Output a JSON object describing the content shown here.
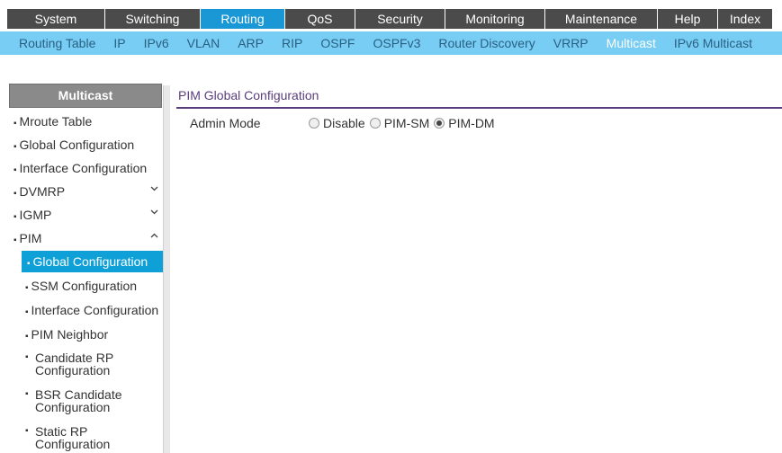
{
  "top_tabs": [
    {
      "label": "System"
    },
    {
      "label": "Switching"
    },
    {
      "label": "Routing",
      "active": true
    },
    {
      "label": "QoS"
    },
    {
      "label": "Security"
    },
    {
      "label": "Monitoring"
    },
    {
      "label": "Maintenance"
    },
    {
      "label": "Help"
    },
    {
      "label": "Index"
    }
  ],
  "sub_tabs": [
    {
      "label": "Routing Table"
    },
    {
      "label": "IP"
    },
    {
      "label": "IPv6"
    },
    {
      "label": "VLAN"
    },
    {
      "label": "ARP"
    },
    {
      "label": "RIP"
    },
    {
      "label": "OSPF"
    },
    {
      "label": "OSPFv3"
    },
    {
      "label": "Router Discovery"
    },
    {
      "label": "VRRP"
    },
    {
      "label": "Multicast",
      "active": true
    },
    {
      "label": "IPv6 Multicast"
    }
  ],
  "sidebar": {
    "header": "Multicast",
    "items": [
      {
        "label": "Mroute Table"
      },
      {
        "label": "Global Configuration"
      },
      {
        "label": "Interface Configuration"
      },
      {
        "label": "DVMRP",
        "chevron": "⌄"
      },
      {
        "label": "IGMP",
        "chevron": "⌄"
      },
      {
        "label": "PIM",
        "chevron": "⌃"
      },
      {
        "label": "Global Configuration"
      },
      {
        "label": "SSM Configuration"
      },
      {
        "label": "Interface Configuration"
      },
      {
        "label": "PIM Neighbor"
      },
      {
        "label": "Candidate RP Configuration"
      },
      {
        "label": "BSR Candidate Configuration"
      },
      {
        "label": "Static RP Configuration"
      }
    ]
  },
  "main": {
    "title": "PIM Global Configuration",
    "admin_mode_label": "Admin Mode",
    "options": [
      {
        "label": "Disable",
        "checked": false
      },
      {
        "label": "PIM-SM",
        "checked": false
      },
      {
        "label": "PIM-DM",
        "checked": true
      }
    ]
  },
  "colors": {
    "active_tab": "#1a97d5",
    "subnav_bg": "#77cdf3",
    "title_purple": "#5a3d7d",
    "selected_item": "#10a0d8"
  }
}
